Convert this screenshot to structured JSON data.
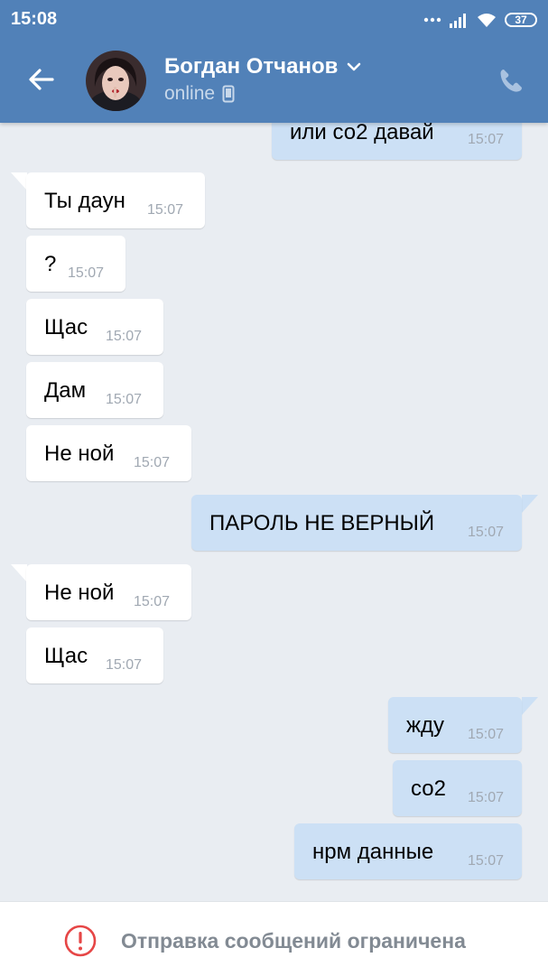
{
  "status_bar": {
    "time": "15:08",
    "battery": "37"
  },
  "header": {
    "contact_name": "Богдан Отчанов",
    "contact_status": "online",
    "accent_color": "#5181b8"
  },
  "messages": [
    {
      "direction": "out",
      "text": "или со2 давай",
      "time": "15:07"
    },
    {
      "direction": "in",
      "text": "Ты даун",
      "time": "15:07"
    },
    {
      "direction": "in",
      "text": "?",
      "time": "15:07"
    },
    {
      "direction": "in",
      "text": "Щас",
      "time": "15:07"
    },
    {
      "direction": "in",
      "text": "Дам",
      "time": "15:07"
    },
    {
      "direction": "in",
      "text": "Не ной",
      "time": "15:07"
    },
    {
      "direction": "out",
      "text": "ПАРОЛЬ НЕ ВЕРНЫЙ",
      "time": "15:07"
    },
    {
      "direction": "in",
      "text": "Не ной",
      "time": "15:07"
    },
    {
      "direction": "in",
      "text": "Щас",
      "time": "15:07"
    },
    {
      "direction": "out",
      "text": "жду",
      "time": "15:07"
    },
    {
      "direction": "out",
      "text": "со2",
      "time": "15:07"
    },
    {
      "direction": "out",
      "text": "нрм данные",
      "time": "15:07"
    }
  ],
  "footer": {
    "restriction_text": "Отправка сообщений ограничена",
    "icon": "alert-circle-icon",
    "icon_color": "#e64646"
  }
}
